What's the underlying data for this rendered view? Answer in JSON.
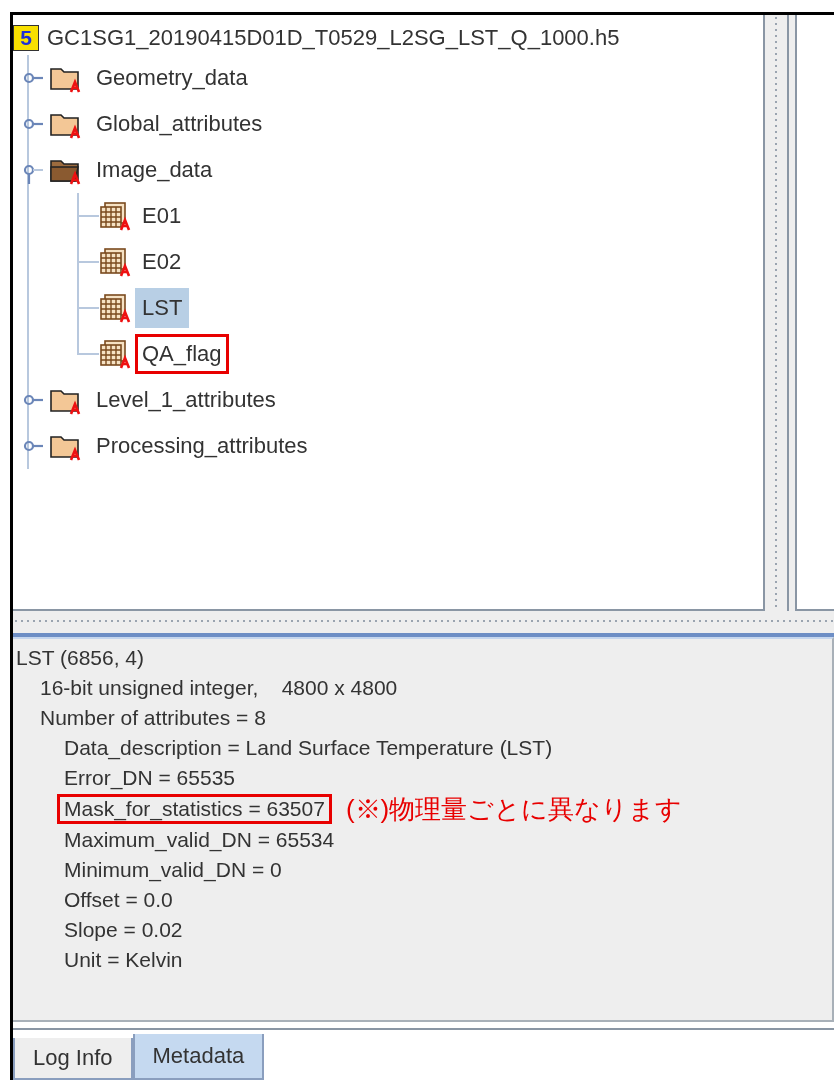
{
  "tree": {
    "root": {
      "badge": "5",
      "label": "GC1SG1_20190415D01D_T0529_L2SG_LST_Q_1000.h5"
    },
    "items": [
      {
        "label": "Geometry_data",
        "kind": "group",
        "expanded": false,
        "selected": false,
        "highlighted": false
      },
      {
        "label": "Global_attributes",
        "kind": "group",
        "expanded": false,
        "selected": false,
        "highlighted": false
      },
      {
        "label": "Image_data",
        "kind": "group",
        "expanded": true,
        "selected": false,
        "highlighted": false,
        "children": [
          {
            "label": "E01",
            "kind": "dataset",
            "selected": false,
            "highlighted": false
          },
          {
            "label": "E02",
            "kind": "dataset",
            "selected": false,
            "highlighted": false
          },
          {
            "label": "LST",
            "kind": "dataset",
            "selected": true,
            "highlighted": false
          },
          {
            "label": "QA_flag",
            "kind": "dataset",
            "selected": false,
            "highlighted": true
          }
        ]
      },
      {
        "label": "Level_1_attributes",
        "kind": "group",
        "expanded": false,
        "selected": false,
        "highlighted": false
      },
      {
        "label": "Processing_attributes",
        "kind": "group",
        "expanded": false,
        "selected": false,
        "highlighted": false
      }
    ]
  },
  "metadata": {
    "lines": [
      {
        "text": "LST (6856, 4)",
        "highlighted": false,
        "children": [
          {
            "text": "16-bit unsigned integer,    4800 x 4800",
            "highlighted": false
          },
          {
            "text": "Number of attributes = 8",
            "highlighted": false,
            "children": [
              {
                "text": "Data_description = Land Surface Temperature (LST)",
                "highlighted": false
              },
              {
                "text": "Error_DN = 65535",
                "highlighted": false
              },
              {
                "text": "Mask_for_statistics = 63507",
                "highlighted": true,
                "note": "(※)物理量ごとに異なります"
              },
              {
                "text": "Maximum_valid_DN = 65534",
                "highlighted": false
              },
              {
                "text": "Minimum_valid_DN = 0",
                "highlighted": false
              },
              {
                "text": "Offset = 0.0",
                "highlighted": false
              },
              {
                "text": "Slope = 0.02",
                "highlighted": false
              },
              {
                "text": "Unit = Kelvin",
                "highlighted": false
              }
            ]
          }
        ]
      }
    ]
  },
  "tabs": [
    {
      "label": "Log Info",
      "selected": false
    },
    {
      "label": "Metadata",
      "selected": true
    }
  ]
}
